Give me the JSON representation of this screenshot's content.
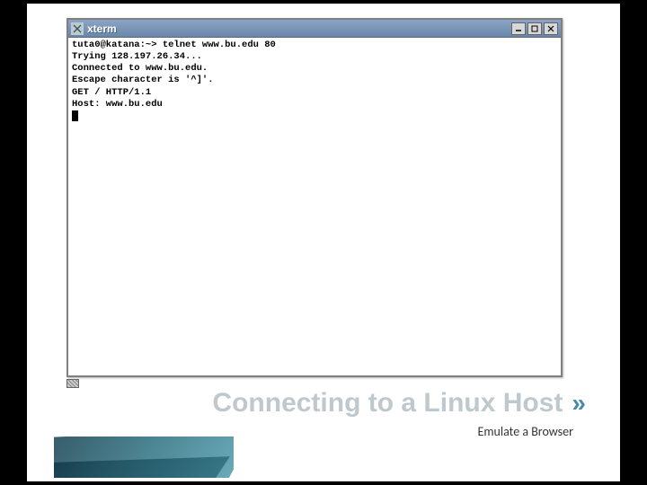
{
  "window": {
    "title": "xterm",
    "icon": "✕"
  },
  "terminal": {
    "line1": "tuta0@katana:~> telnet www.bu.edu 80",
    "line2": "Trying 128.197.26.34...",
    "line3": "Connected to www.bu.edu.",
    "line4": "Escape character is '^]'.",
    "line5": "GET / HTTP/1.1",
    "line6": "Host: www.bu.edu"
  },
  "slide": {
    "title": "Connecting to a Linux Host",
    "chevrons": "»",
    "subtitle": "Emulate a Browser"
  }
}
